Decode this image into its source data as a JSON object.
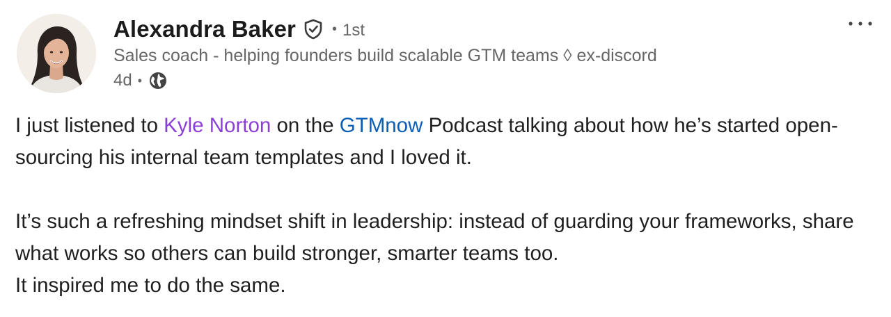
{
  "author": {
    "name": "Alexandra Baker",
    "verified_icon": "verified-shield-icon",
    "separator": "•",
    "degree": "1st",
    "headline": "Sales coach - helping founders build scalable GTM teams ◊ ex-discord",
    "time": "4d",
    "meta_separator": "•",
    "visibility_icon": "globe-icon"
  },
  "menu": {
    "icon": "more-horizontal-icon"
  },
  "post": {
    "p1_before_mention": "I just listened to ",
    "mention": "Kyle Norton",
    "p1_middle": " on the ",
    "company": "GTMnow",
    "p1_after": " Podcast talking about how he’s started open-sourcing his internal team templates and I loved it.",
    "p2_line1": "It’s such a refreshing mindset shift in leadership: instead of guarding your frameworks, share what works so others can build stronger, smarter teams too.",
    "p2_line2": "It inspired me to do the same."
  },
  "colors": {
    "mention": "#8c3fd6",
    "company": "#0b5fb7",
    "secondary_text": "#666666",
    "primary_text": "#1f1f1f"
  }
}
